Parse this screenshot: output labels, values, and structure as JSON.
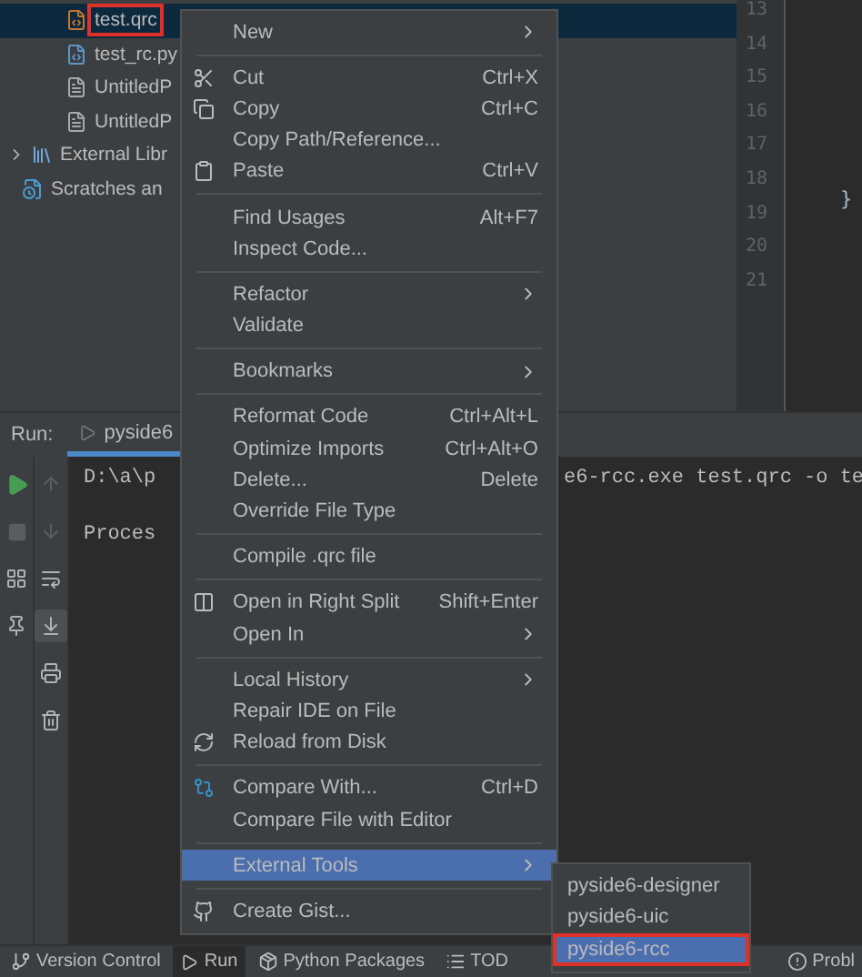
{
  "project_tree": [
    {
      "label": "test.qrc",
      "selected": true,
      "kind": "qrc"
    },
    {
      "label": "test_rc.py",
      "selected": false,
      "kind": "python"
    },
    {
      "label": "UntitledP",
      "selected": false,
      "kind": "file"
    },
    {
      "label": "UntitledP",
      "selected": false,
      "kind": "file"
    },
    {
      "label": "External Libr",
      "selected": false,
      "kind": "library",
      "expanded": false
    },
    {
      "label": "Scratches an",
      "selected": false,
      "kind": "scratch"
    }
  ],
  "editor": {
    "line_numbers": [
      "13",
      "14",
      "15",
      "16",
      "17",
      "18",
      "19",
      "20",
      "21"
    ],
    "brace": "}"
  },
  "run_panel": {
    "label": "Run:",
    "tab": {
      "label": "pyside6",
      "selected": true
    },
    "console": [
      {
        "left": "D:\\a\\p",
        "right": "e6-rcc.exe test.qrc -o te"
      },
      {
        "left": "Proces"
      }
    ]
  },
  "context_menu": [
    {
      "kind": "item",
      "label": "New",
      "submenu": true
    },
    {
      "kind": "separator"
    },
    {
      "kind": "item",
      "label": "Cut",
      "shortcut": "Ctrl+X",
      "has_icon": true
    },
    {
      "kind": "item",
      "label": "Copy",
      "shortcut": "Ctrl+C",
      "has_icon": true
    },
    {
      "kind": "item",
      "label": "Copy Path/Reference..."
    },
    {
      "kind": "item",
      "label": "Paste",
      "shortcut": "Ctrl+V",
      "has_icon": true
    },
    {
      "kind": "separator"
    },
    {
      "kind": "item",
      "label": "Find Usages",
      "shortcut": "Alt+F7"
    },
    {
      "kind": "item",
      "label": "Inspect Code..."
    },
    {
      "kind": "separator"
    },
    {
      "kind": "item",
      "label": "Refactor",
      "submenu": true
    },
    {
      "kind": "item",
      "label": "Validate"
    },
    {
      "kind": "separator"
    },
    {
      "kind": "item",
      "label": "Bookmarks",
      "submenu": true
    },
    {
      "kind": "separator"
    },
    {
      "kind": "item",
      "label": "Reformat Code",
      "shortcut": "Ctrl+Alt+L"
    },
    {
      "kind": "item",
      "label": "Optimize Imports",
      "shortcut": "Ctrl+Alt+O"
    },
    {
      "kind": "item",
      "label": "Delete...",
      "shortcut": "Delete"
    },
    {
      "kind": "item",
      "label": "Override File Type"
    },
    {
      "kind": "separator"
    },
    {
      "kind": "item",
      "label": "Compile .qrc file"
    },
    {
      "kind": "separator"
    },
    {
      "kind": "item",
      "label": "Open in Right Split",
      "shortcut": "Shift+Enter",
      "has_icon": true
    },
    {
      "kind": "item",
      "label": "Open In",
      "submenu": true
    },
    {
      "kind": "separator"
    },
    {
      "kind": "item",
      "label": "Local History",
      "submenu": true
    },
    {
      "kind": "item",
      "label": "Repair IDE on File"
    },
    {
      "kind": "item",
      "label": "Reload from Disk",
      "has_icon": true
    },
    {
      "kind": "separator"
    },
    {
      "kind": "item",
      "label": "Compare With...",
      "shortcut": "Ctrl+D",
      "has_icon": true
    },
    {
      "kind": "item",
      "label": "Compare File with Editor"
    },
    {
      "kind": "separator"
    },
    {
      "kind": "item",
      "label": "External Tools",
      "submenu": true,
      "selected": true
    },
    {
      "kind": "separator"
    },
    {
      "kind": "item",
      "label": "Create Gist...",
      "has_icon": true
    }
  ],
  "submenu": [
    {
      "label": "pyside6-designer",
      "selected": false
    },
    {
      "label": "pyside6-uic",
      "selected": false
    },
    {
      "label": "pyside6-rcc",
      "selected": true
    }
  ],
  "bottom_bar": [
    {
      "label": "Version Control",
      "selected": false
    },
    {
      "label": "Run",
      "selected": true
    },
    {
      "label": "Python Packages",
      "selected": false
    },
    {
      "label": "TOD",
      "selected": false
    },
    {
      "label": "Probl",
      "selected": false
    }
  ]
}
